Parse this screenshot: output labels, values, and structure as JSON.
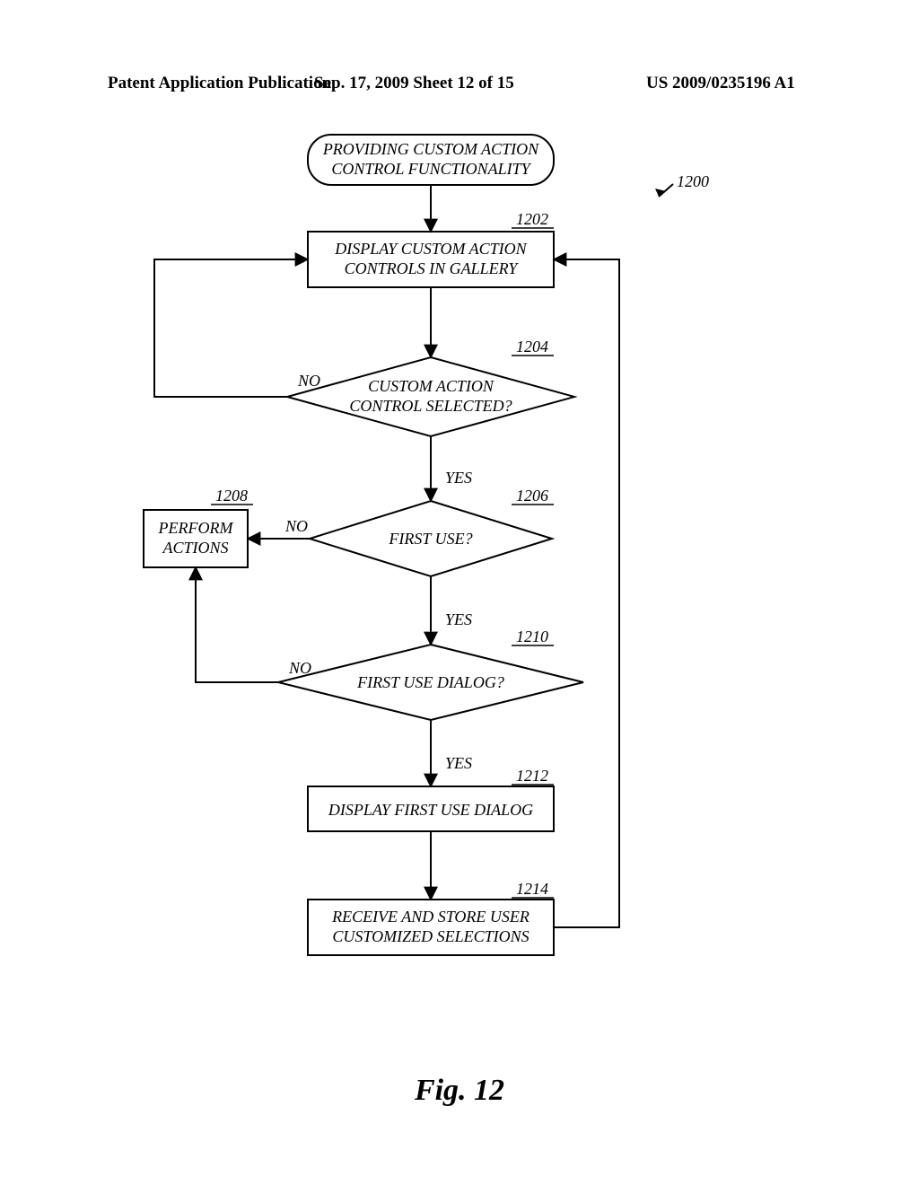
{
  "header": {
    "left": "Patent Application Publication",
    "center": "Sep. 17, 2009  Sheet 12 of 15",
    "right": "US 2009/0235196 A1"
  },
  "refs": {
    "fig": "1200",
    "r1202": "1202",
    "r1204": "1204",
    "r1206": "1206",
    "r1208": "1208",
    "r1210": "1210",
    "r1212": "1212",
    "r1214": "1214"
  },
  "nodes": {
    "start_l1": "PROVIDING CUSTOM ACTION",
    "start_l2": "CONTROL FUNCTIONALITY",
    "b1202_l1": "DISPLAY CUSTOM ACTION",
    "b1202_l2": "CONTROLS IN GALLERY",
    "d1204_l1": "CUSTOM ACTION",
    "d1204_l2": "CONTROL SELECTED?",
    "d1206": "FIRST USE?",
    "b1208_l1": "PERFORM",
    "b1208_l2": "ACTIONS",
    "d1210": "FIRST USE DIALOG?",
    "b1212": "DISPLAY FIRST USE DIALOG",
    "b1214_l1": "RECEIVE AND STORE USER",
    "b1214_l2": "CUSTOMIZED SELECTIONS"
  },
  "labels": {
    "yes": "YES",
    "no": "NO"
  },
  "figure_caption": "Fig. 12"
}
